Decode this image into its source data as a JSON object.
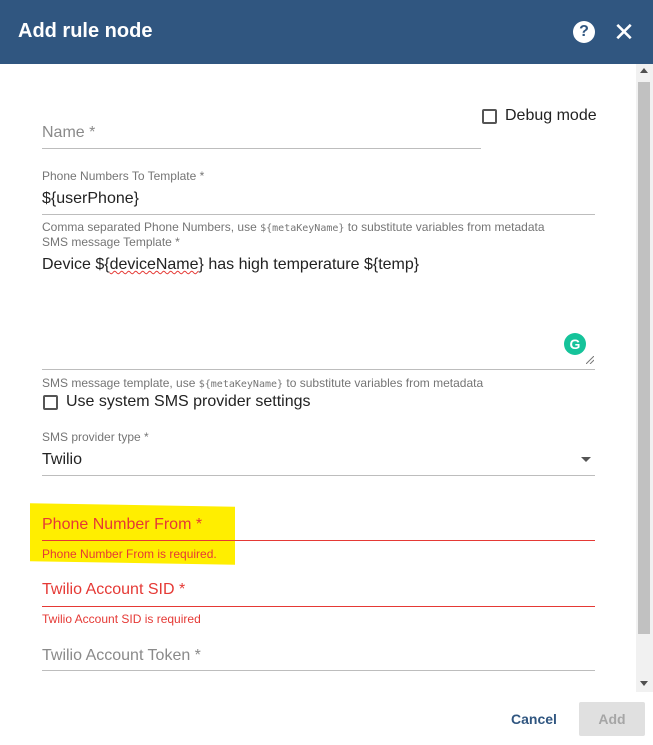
{
  "dialog": {
    "title": "Add rule node",
    "help_icon": "?",
    "close_icon": "✕"
  },
  "form": {
    "name": {
      "placeholder": "Name *",
      "value": ""
    },
    "debug_mode": {
      "label": "Debug mode",
      "checked": false
    },
    "phone_numbers": {
      "label": "Phone Numbers To Template *",
      "value": "${userPhone}",
      "hint_prefix": "Comma separated Phone Numbers, use ",
      "hint_code": "${metaKeyName}",
      "hint_suffix": " to substitute variables from metadata"
    },
    "sms_template": {
      "label": "SMS message Template *",
      "value_prefix": "Device ${",
      "value_misspelled": "deviceName",
      "value_suffix": "} has high temperature ${temp}",
      "hint_prefix": "SMS message template, use ",
      "hint_code": "${metaKeyName}",
      "hint_suffix": " to substitute variables from metadata",
      "grammarly_icon": "G"
    },
    "use_system_sms": {
      "label": "Use system SMS provider settings",
      "checked": false
    },
    "sms_provider_type": {
      "label": "SMS provider type *",
      "value": "Twilio"
    },
    "phone_number_from": {
      "placeholder": "Phone Number From *",
      "error": "Phone Number From is required."
    },
    "twilio_account_sid": {
      "placeholder": "Twilio Account SID *",
      "error": "Twilio Account SID is required"
    },
    "twilio_account_token": {
      "placeholder": "Twilio Account Token *"
    }
  },
  "footer": {
    "cancel_label": "Cancel",
    "add_label": "Add"
  },
  "colors": {
    "header": "#305680",
    "error": "#e53935",
    "highlight": "#ffee00"
  }
}
